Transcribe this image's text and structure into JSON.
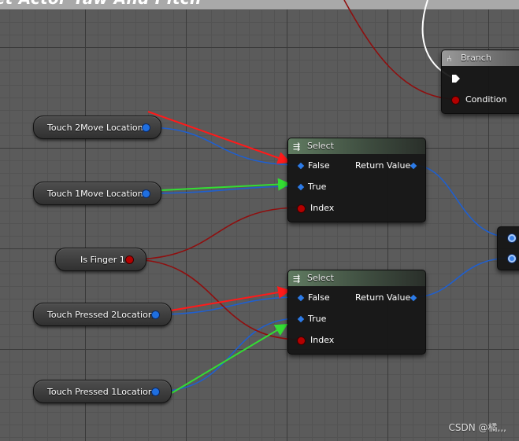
{
  "graph": {
    "title": "Set Actor Yaw And Pitch",
    "watermark": "CSDN @橘,,,"
  },
  "variables": [
    {
      "name": "Touch 2Move Location",
      "pin_type": "vector"
    },
    {
      "name": "Touch 1Move Location",
      "pin_type": "vector"
    },
    {
      "name": "Is Finger 1",
      "pin_type": "boolean"
    },
    {
      "name": "Touch Pressed 2Location",
      "pin_type": "vector"
    },
    {
      "name": "Touch Pressed 1Location",
      "pin_type": "vector"
    }
  ],
  "select_nodes": [
    {
      "title": "Select",
      "icon": "select-icon",
      "inputs": [
        "False",
        "True",
        "Index"
      ],
      "output": "Return Value"
    },
    {
      "title": "Select",
      "icon": "select-icon",
      "inputs": [
        "False",
        "True",
        "Index"
      ],
      "output": "Return Value"
    }
  ],
  "branch_node": {
    "title": "Branch",
    "icon": "branch-icon",
    "condition": "Condition"
  },
  "colors": {
    "vector_pin": "#1f6fe0",
    "bool_pin": "#b30000",
    "exec_wire": "#ffffff",
    "annotation_red": "#ff1a1a",
    "annotation_green": "#33dd33"
  }
}
